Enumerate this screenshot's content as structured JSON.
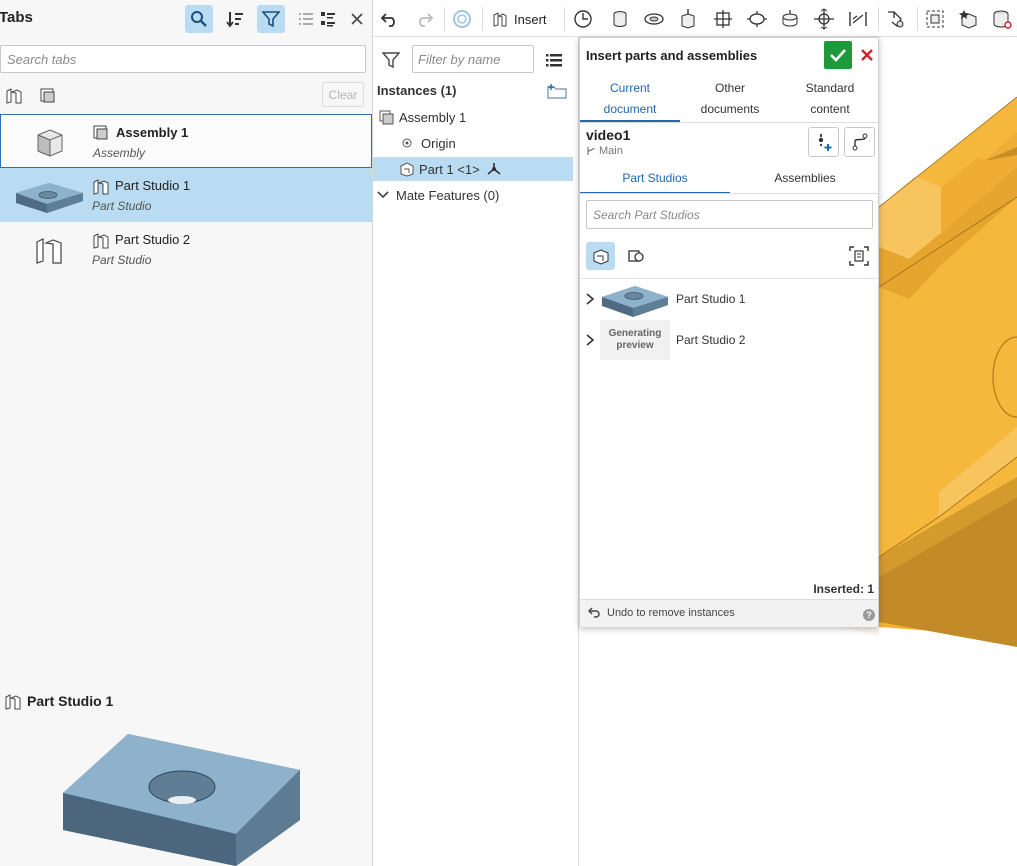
{
  "tabs_panel": {
    "title": "Tabs",
    "search_placeholder": "Search tabs",
    "clear_label": "Clear",
    "items": [
      {
        "name": "Assembly 1",
        "type": "Assembly"
      },
      {
        "name": "Part Studio 1",
        "type": "Part Studio"
      },
      {
        "name": "Part Studio 2",
        "type": "Part Studio"
      }
    ],
    "preview_title": "Part Studio 1"
  },
  "toolbar": {
    "insert_label": "Insert"
  },
  "instances_panel": {
    "filter_placeholder": "Filter by name",
    "heading": "Instances (1)",
    "tree": {
      "assembly": "Assembly 1",
      "origin": "Origin",
      "part": "Part 1 <1>",
      "mate_features": "Mate Features (0)"
    }
  },
  "insert_dialog": {
    "title": "Insert parts and assemblies",
    "source_tabs": [
      {
        "line1": "Current",
        "line2": "document"
      },
      {
        "line1": "Other",
        "line2": "documents"
      },
      {
        "line1": "Standard",
        "line2": "content"
      }
    ],
    "document_name": "video1",
    "branch": "Main",
    "sub_tabs": [
      "Part Studios",
      "Assemblies"
    ],
    "search_placeholder": "Search Part Studios",
    "items": [
      "Part Studio 1",
      "Part Studio 2"
    ],
    "generating_line1": "Generating",
    "generating_line2": "preview",
    "inserted": "Inserted: 1",
    "undo_label": "Undo to remove instances"
  },
  "colors": {
    "accent_blue": "#2068b0",
    "selection_blue": "#b9dcf2",
    "ok_green": "#1f9a3b",
    "cancel_red": "#c8242b",
    "part_orange": "#f2b132",
    "part_blue_gray": "#8fb2cc"
  }
}
